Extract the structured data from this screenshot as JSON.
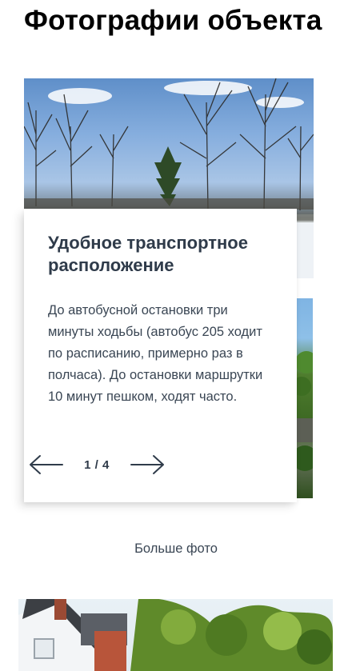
{
  "page": {
    "title": "Фотографии объекта"
  },
  "slider": {
    "card_title": "Удобное транспортное расположение",
    "card_text": "До автобусной остановки три минуты ходьбы (автобус 205 ходит по расписанию, примерно раз в полчаса). До остановки маршрутки 10 минут пешком, ходят часто.",
    "counter": "1 / 4",
    "prev_icon": "arrow-left-icon",
    "next_icon": "arrow-right-icon"
  },
  "more_photos_label": "Больше фото",
  "colors": {
    "title": "#000000",
    "card_heading": "#2f3b4a",
    "body_text": "#3a4654"
  }
}
